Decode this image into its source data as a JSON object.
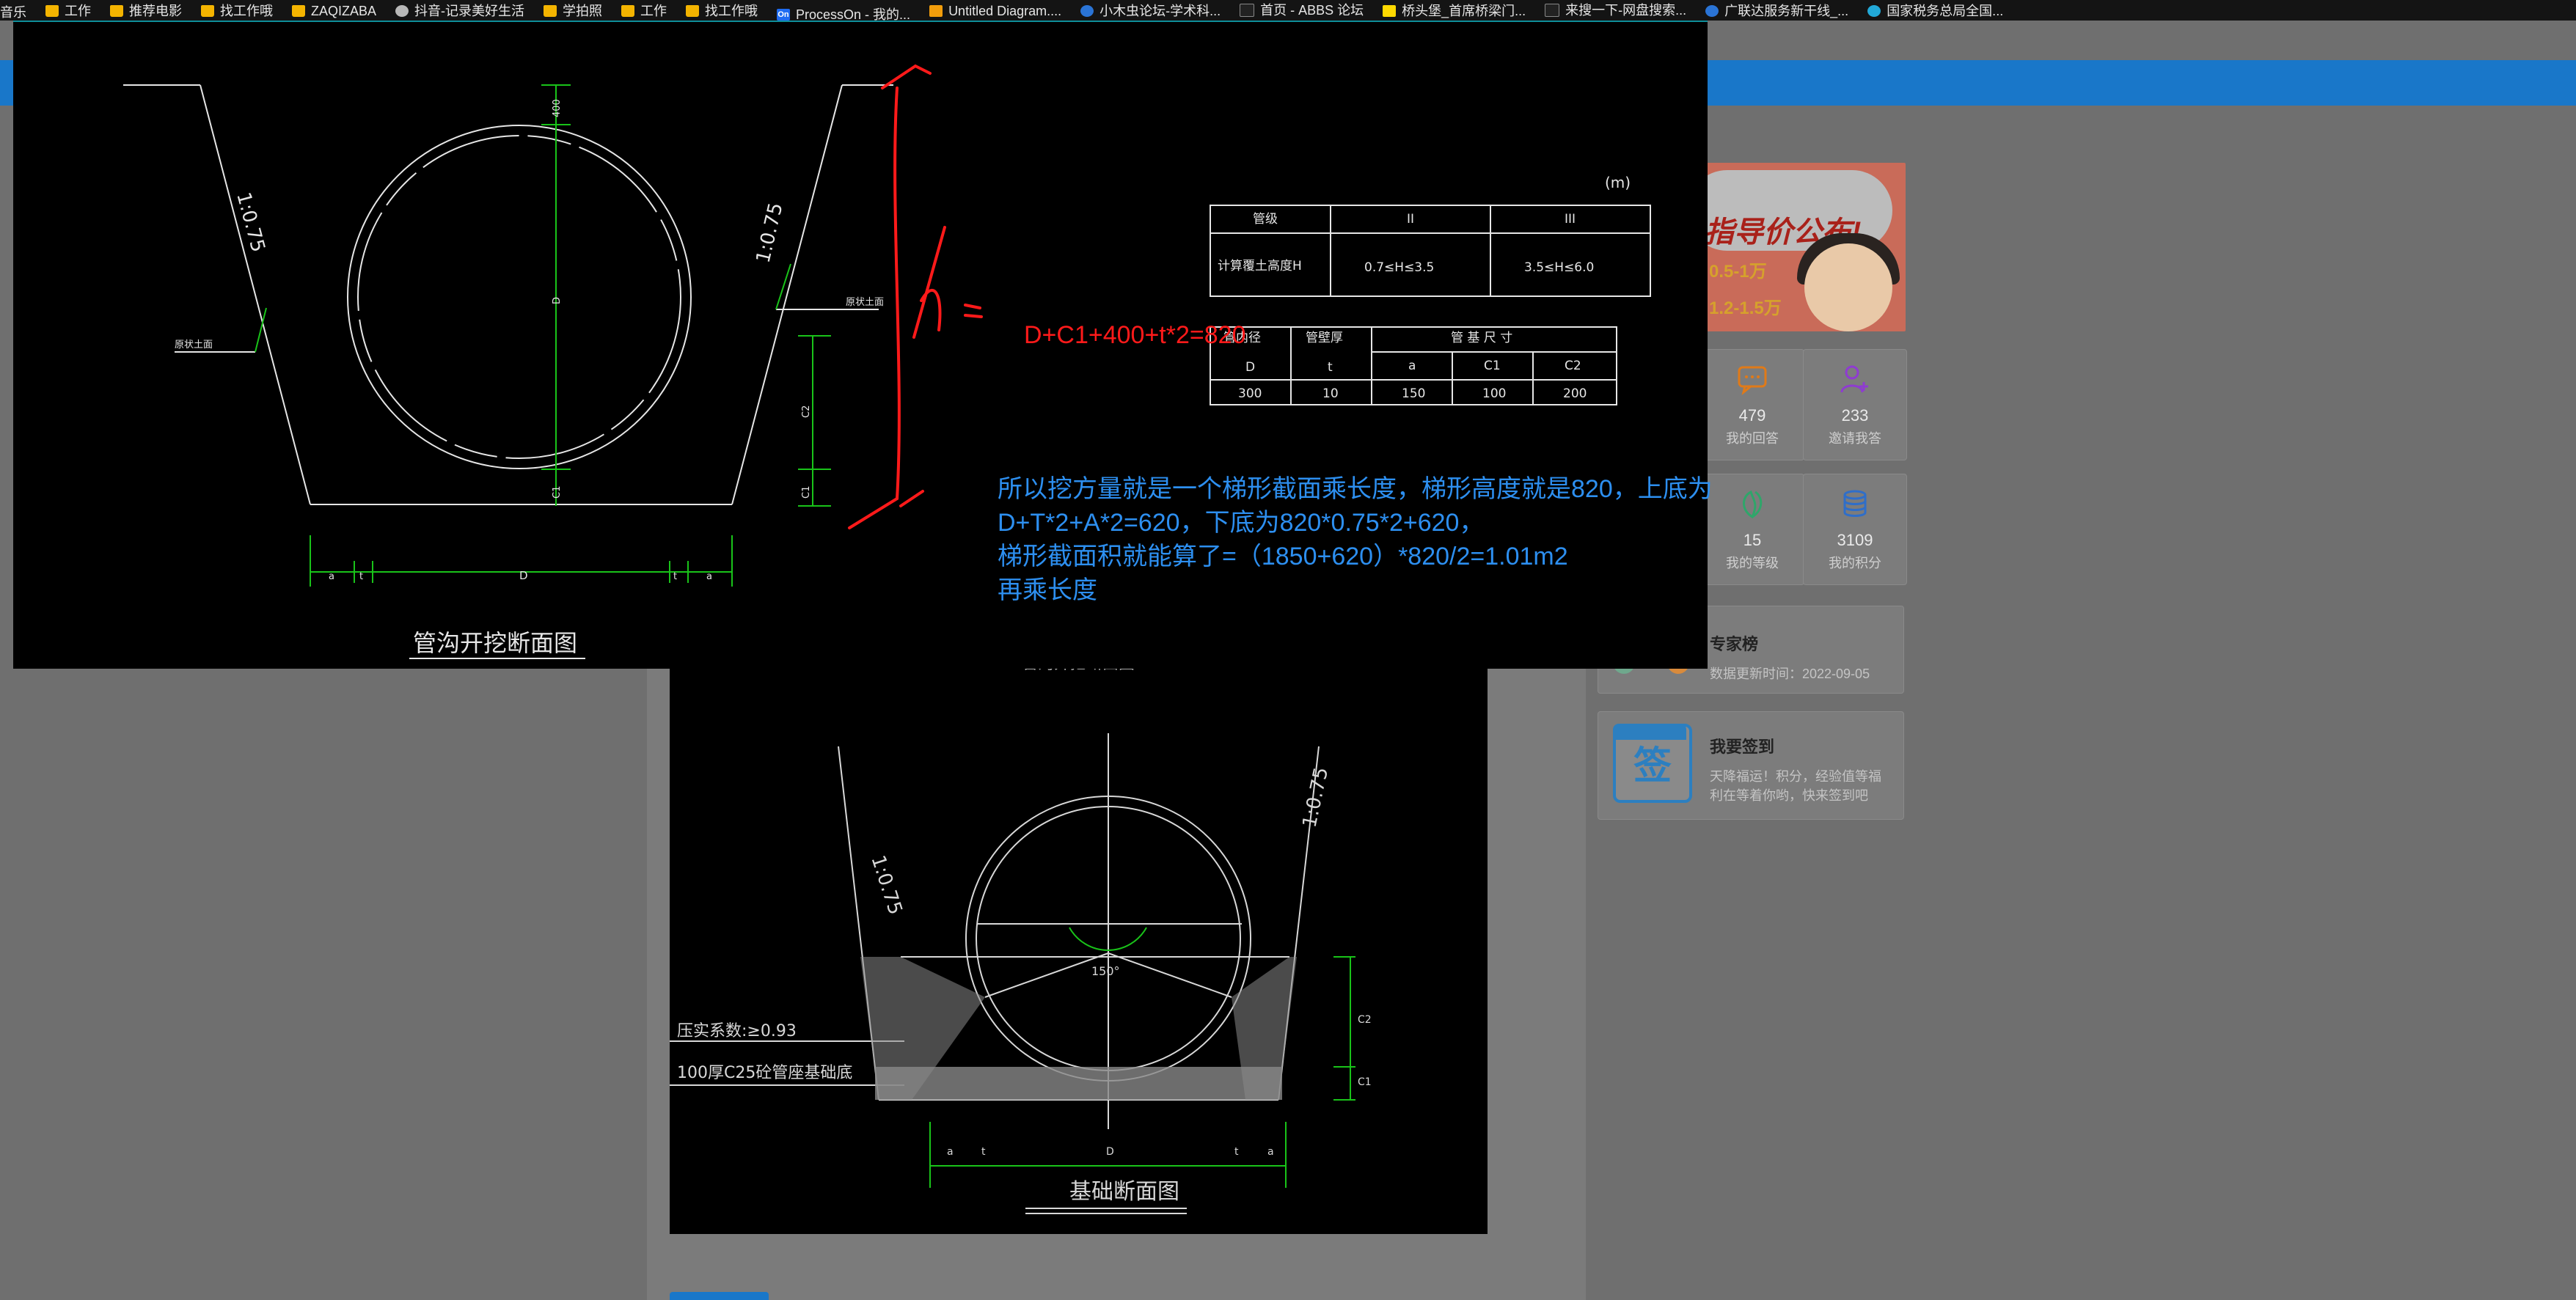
{
  "bookmarks": [
    {
      "label": "音乐",
      "icon": "none"
    },
    {
      "label": "工作",
      "icon": "folder"
    },
    {
      "label": "推荐电影",
      "icon": "folder"
    },
    {
      "label": "找工作哦",
      "icon": "folder"
    },
    {
      "label": "ZAQIZABA",
      "icon": "folder"
    },
    {
      "label": "抖音-记录美好生活",
      "icon": "globe"
    },
    {
      "label": "学拍照",
      "icon": "folder"
    },
    {
      "label": "工作",
      "icon": "folder"
    },
    {
      "label": "找工作哦",
      "icon": "folder"
    },
    {
      "label": "ProcessOn - 我的...",
      "icon": "on"
    },
    {
      "label": "Untitled Diagram....",
      "icon": "warn"
    },
    {
      "label": "小木虫论坛-学术科...",
      "icon": "blue"
    },
    {
      "label": "首页 - ABBS 论坛",
      "icon": "dark"
    },
    {
      "label": "桥头堡_首席桥梁门...",
      "icon": "yellow"
    },
    {
      "label": "来搜一下-网盘搜索...",
      "icon": "dark"
    },
    {
      "label": "广联达服务新干线_...",
      "icon": "blue"
    },
    {
      "label": "国家税务总局全国...",
      "icon": "cyan"
    }
  ],
  "sidebar": {
    "banner": {
      "line1": "指导价公布!",
      "line2": "0.5-1万",
      "line3": "1.2-1.5万"
    },
    "stats": [
      {
        "value": "479",
        "label": "我的回答",
        "icon": "chat-icon",
        "color": "#e07a18"
      },
      {
        "value": "233",
        "label": "邀请我答",
        "icon": "user-plus-icon",
        "color": "#8f3bd1"
      },
      {
        "value": "15",
        "label": "我的等级",
        "icon": "leaf-icon",
        "color": "#2fa66a"
      },
      {
        "value": "3109",
        "label": "我的积分",
        "icon": "coins-icon",
        "color": "#2f6ec9"
      }
    ],
    "experts": {
      "title": "专家榜",
      "subtitle": "数据更新时间：2022-09-05"
    },
    "checkin": {
      "icon_text": "签",
      "title": "我要签到",
      "desc1": "天降福运！积分，经验值等福",
      "desc2": "利在等着你哟，快来签到吧"
    }
  },
  "overlay": {
    "drawing_title": "管沟开挖断面图",
    "unit_note": "(m)",
    "slope_left": "1:0.75",
    "slope_right": "1:0.75",
    "label_left": "原状土面",
    "label_right": "原状土面",
    "dim_top": "400",
    "dim_d": "D",
    "dim_c1": "C1",
    "dim_c2": "C2",
    "bottom_dims": [
      "a",
      "t",
      "D",
      "t",
      "a"
    ],
    "table1": {
      "headers": [
        "管级",
        "II",
        "III"
      ],
      "row": [
        "计算覆土高度H",
        "0.7≤H≤3.5",
        "3.5≤H≤6.0"
      ]
    },
    "table2": {
      "head1": [
        "管内径",
        "管壁厚",
        "管 基 尺 寸"
      ],
      "head2": [
        "D",
        "t",
        "a",
        "C1",
        "C2"
      ],
      "row": [
        "300",
        "10",
        "150",
        "100",
        "200"
      ]
    },
    "handwritten_h": "h=",
    "formula": "D+C1+400+t*2=820",
    "note_lines": [
      "所以挖方量就是一个梯形截面乘长度，梯形高度就是820，上底为",
      "D+T*2+A*2=620，下底为820*0.75*2+620，",
      "梯形截面积就能算了=（1850+620）*820/2=1.01m2",
      "再乘长度"
    ]
  },
  "lower": {
    "top_caption": "管沟开挖断面图",
    "title": "基础断面图",
    "slope_left": "1:0.75",
    "slope_right": "1:0.75",
    "angle": "150°",
    "note1": "压实系数:≥0.93",
    "note2": "100厚C25砼管座基础底",
    "dim_c1": "C1",
    "dim_c2": "C2",
    "bottom_dims": [
      "a",
      "t",
      "D",
      "t",
      "a"
    ]
  }
}
